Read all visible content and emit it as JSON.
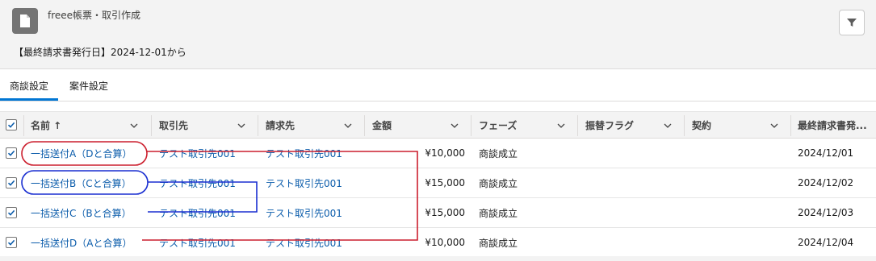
{
  "header": {
    "app_title": "freee帳票・取引作成",
    "filter_info": "【最終請求書発行日】2024-12-01から"
  },
  "tabs": [
    {
      "label": "商談設定",
      "active": true
    },
    {
      "label": "案件設定",
      "active": false
    }
  ],
  "table": {
    "columns": [
      {
        "label": "名前 ↑"
      },
      {
        "label": "取引先"
      },
      {
        "label": "請求先"
      },
      {
        "label": "金額"
      },
      {
        "label": "フェーズ"
      },
      {
        "label": "振替フラグ"
      },
      {
        "label": "契約"
      },
      {
        "label": "最終請求書発..."
      }
    ],
    "rows": [
      {
        "name": "一括送付A（Dと合算）",
        "account": "テスト取引先001",
        "billing": "テスト取引先001",
        "amount": "¥10,000",
        "phase": "商談成立",
        "transfer": "",
        "contract": "",
        "last_invoice": "2024/12/01",
        "checked": true
      },
      {
        "name": "一括送付B（Cと合算）",
        "account": "テスト取引先001",
        "billing": "テスト取引先001",
        "amount": "¥15,000",
        "phase": "商談成立",
        "transfer": "",
        "contract": "",
        "last_invoice": "2024/12/02",
        "checked": true
      },
      {
        "name": "一括送付C（Bと合算）",
        "account": "テスト取引先001",
        "billing": "テスト取引先001",
        "amount": "¥15,000",
        "phase": "商談成立",
        "transfer": "",
        "contract": "",
        "last_invoice": "2024/12/03",
        "checked": true
      },
      {
        "name": "一括送付D（Aと合算）",
        "account": "テスト取引先001",
        "billing": "テスト取引先001",
        "amount": "¥10,000",
        "phase": "商談成立",
        "transfer": "",
        "contract": "",
        "last_invoice": "2024/12/04",
        "checked": true
      }
    ]
  },
  "colors": {
    "link": "#0b5cab",
    "accent": "#0176d3",
    "annotation_red": "#cc1f2e",
    "annotation_blue": "#1a2fd1"
  },
  "icons": {
    "app": "document-icon",
    "filter": "funnel-icon",
    "sort": "arrow-up-icon",
    "column_menu": "chevron-down-icon",
    "checkbox": "checkmark-icon"
  }
}
